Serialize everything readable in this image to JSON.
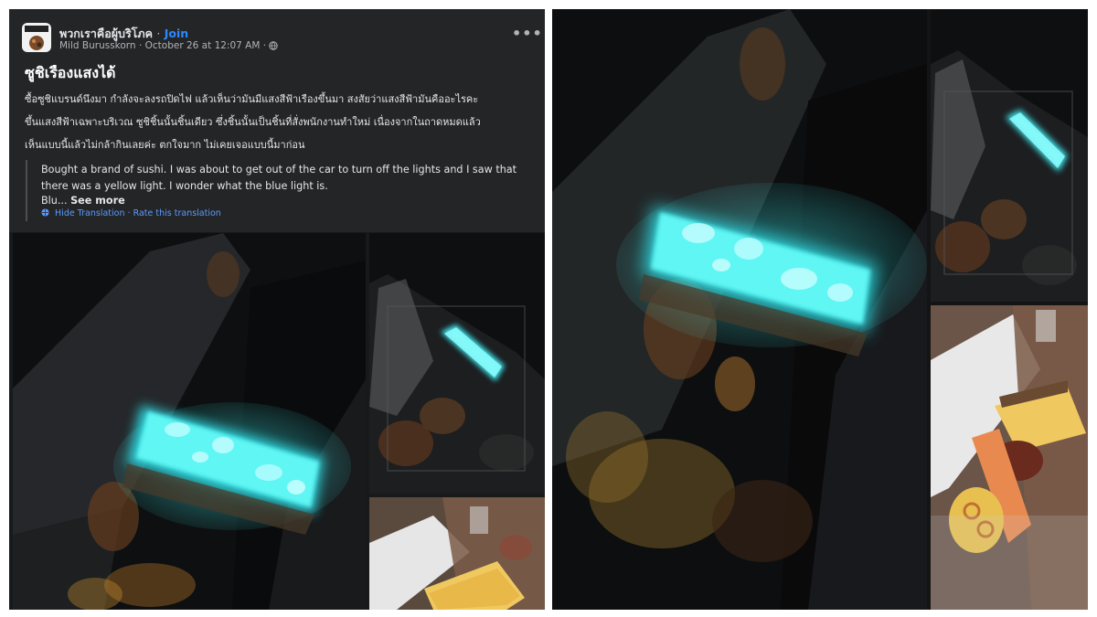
{
  "post": {
    "group_name": "พวกเราคือผู้บริโภค",
    "separator": "·",
    "join_label": "Join",
    "author": "Mild Burusskorn",
    "timestamp": "October 26 at 12:07 AM",
    "more_label": "•••",
    "title": "ซูชิเรืองแสงได้",
    "body_lines": [
      "ซื้อซูชิแบรนด์นึงมา กำลังจะลงรถปิดไฟ แล้วเห็นว่ามันมีแสงสีฟ้าเรืองขึ้นมา สงสัยว่าแสงสีฟ้ามันคืออะไรคะ",
      "ขึ้นแสงสีฟ้าเฉพาะบริเวณ ซูชิชิ้นนั้นชิ้นเดียว ซึ่งชิ้นนั้นเป็นชิ้นที่สั่งพนักงานทำใหม่ เนื่องจากในถาดหมดแล้ว",
      "เห็นแบบนี้แล้วไม่กล้ากินเลยค่ะ ตกใจมาก ไม่เคยเจอแบบนี้มาก่อน"
    ],
    "translation": {
      "lines": [
        "Bought a brand of sushi. I was about to get out of the car to turn off the lights and I saw that",
        "there was a yellow light. I wonder what the blue light is.",
        "Blu..."
      ],
      "see_more_label": "See more",
      "hide_label": "Hide Translation",
      "rate_label": "Rate this translation",
      "link_separator": "·"
    }
  },
  "icons": {
    "audience": "globe-icon",
    "translation": "globe-icon",
    "more": "more-dots-icon"
  },
  "colors": {
    "facebook_bg": "#242526",
    "link_blue": "#2d88ff",
    "glow_cyan": "#3ff0f0"
  }
}
